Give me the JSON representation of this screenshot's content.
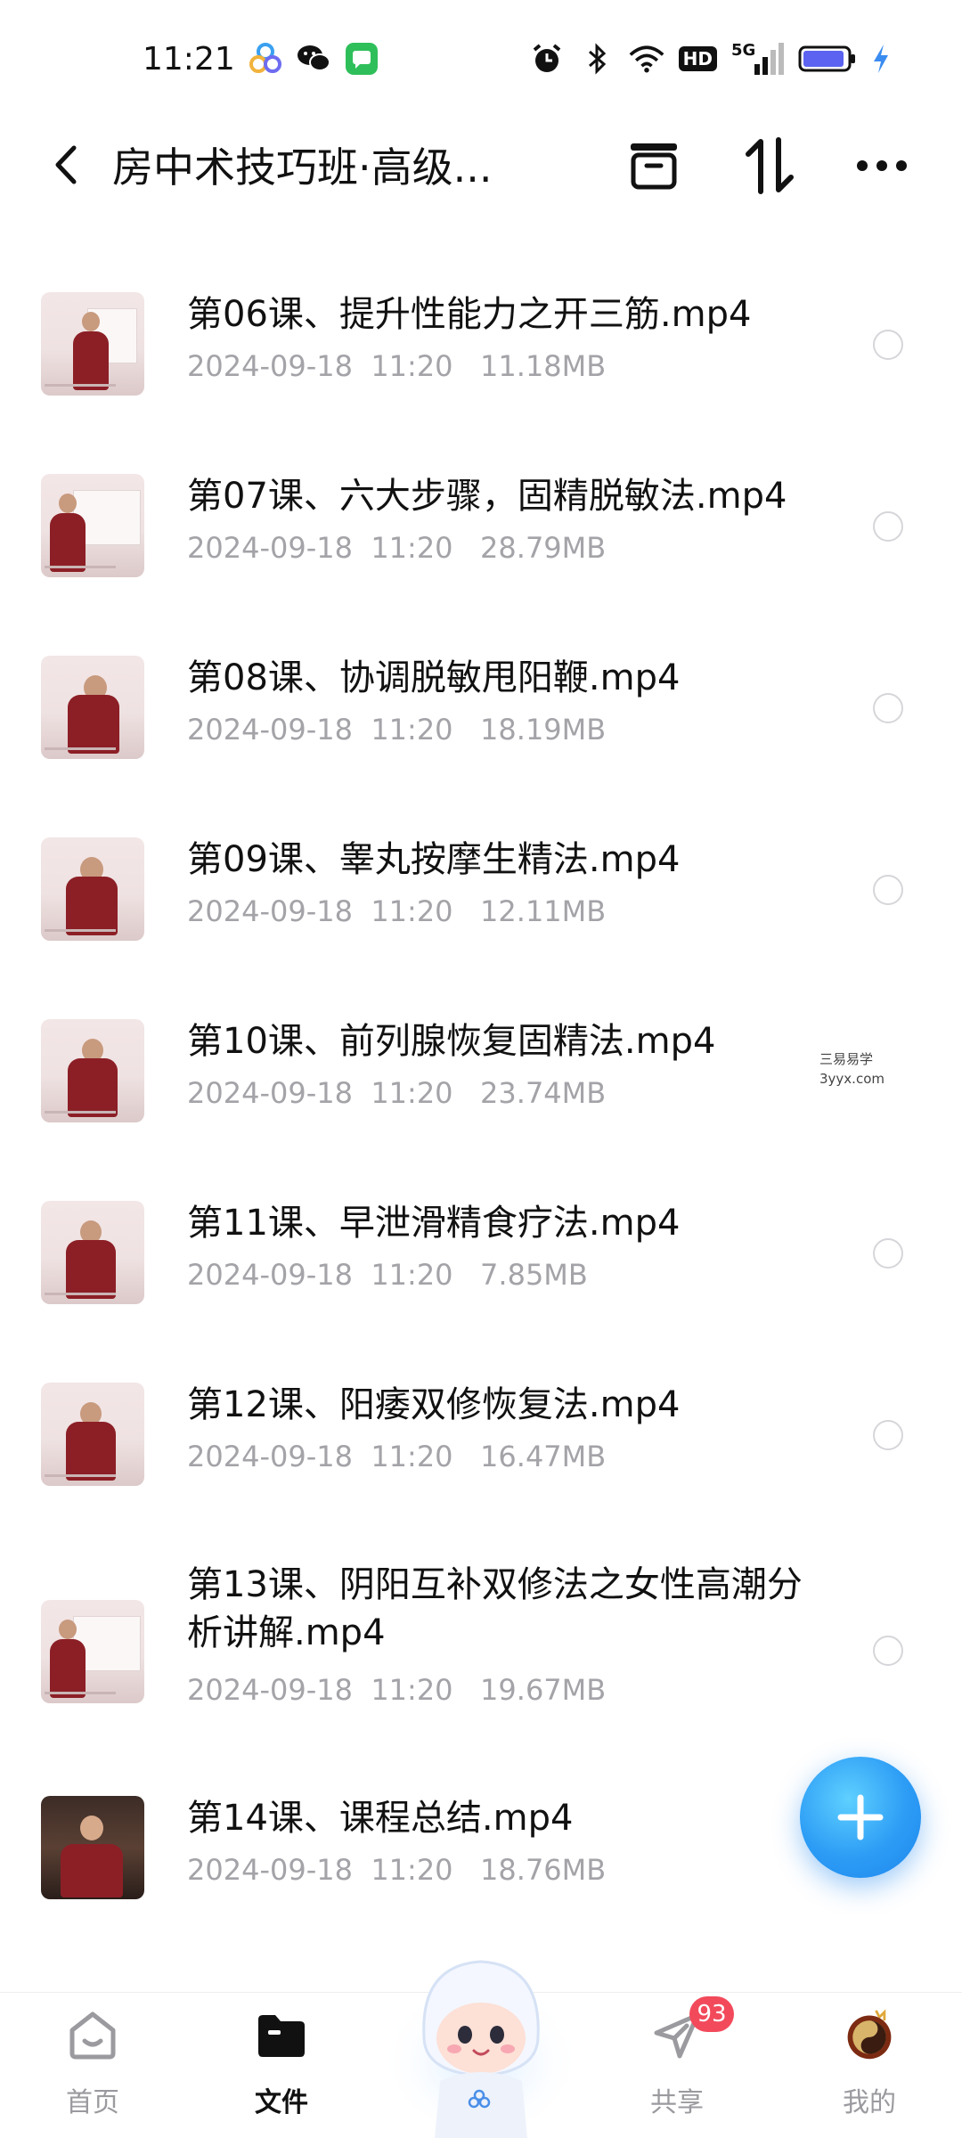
{
  "status_bar": {
    "time": "11:21",
    "network": "5G",
    "hd": "HD",
    "icons": [
      "baidu-netdisk-icon",
      "wechat-icon",
      "message-icon",
      "alarm-icon",
      "bluetooth-icon",
      "wifi-icon",
      "signal-icon",
      "battery-icon",
      "charging-icon"
    ],
    "battery_level": 0.9
  },
  "title_bar": {
    "title": "房中术技巧班·高级...",
    "actions": [
      "archive-icon",
      "sort-icon",
      "more-icon"
    ]
  },
  "files": [
    {
      "name": "第06课、提升性能力之开三筋.mp4",
      "date": "2024-09-18",
      "time": "11:20",
      "size": "11.18MB"
    },
    {
      "name": "第07课、六大步骤，固精脱敏法.mp4",
      "date": "2024-09-18",
      "time": "11:20",
      "size": "28.79MB"
    },
    {
      "name": "第08课、协调脱敏甩阳鞭.mp4",
      "date": "2024-09-18",
      "time": "11:20",
      "size": "18.19MB"
    },
    {
      "name": "第09课、睾丸按摩生精法.mp4",
      "date": "2024-09-18",
      "time": "11:20",
      "size": "12.11MB"
    },
    {
      "name": "第10课、前列腺恢复固精法.mp4",
      "date": "2024-09-18",
      "time": "11:20",
      "size": "23.74MB"
    },
    {
      "name": "第11课、早泄滑精食疗法.mp4",
      "date": "2024-09-18",
      "time": "11:20",
      "size": "7.85MB"
    },
    {
      "name": "第12课、阳痿双修恢复法.mp4",
      "date": "2024-09-18",
      "time": "11:20",
      "size": "16.47MB"
    },
    {
      "name": "第13课、阴阳互补双修法之女性高潮分析讲解.mp4",
      "date": "2024-09-18",
      "time": "11:20",
      "size": "19.67MB"
    },
    {
      "name": "第14课、课程总结.mp4",
      "date": "2024-09-18",
      "time": "11:20",
      "size": "18.76MB"
    }
  ],
  "watermark": {
    "line1": "三易易学",
    "line2": "3yyx.com"
  },
  "bottom_nav": {
    "items": [
      {
        "label": "首页",
        "icon": "home-icon"
      },
      {
        "label": "文件",
        "icon": "folder-icon"
      },
      {
        "label": "",
        "icon": "ai-mascot-icon"
      },
      {
        "label": "共享",
        "icon": "share-paper-plane-icon",
        "badge": "93"
      },
      {
        "label": "我的",
        "icon": "profile-avatar-icon"
      }
    ],
    "active": "文件"
  },
  "colors": {
    "accent": "#2c9cf5",
    "badge": "#f24a5b",
    "meta_text": "#a3a3a8"
  }
}
